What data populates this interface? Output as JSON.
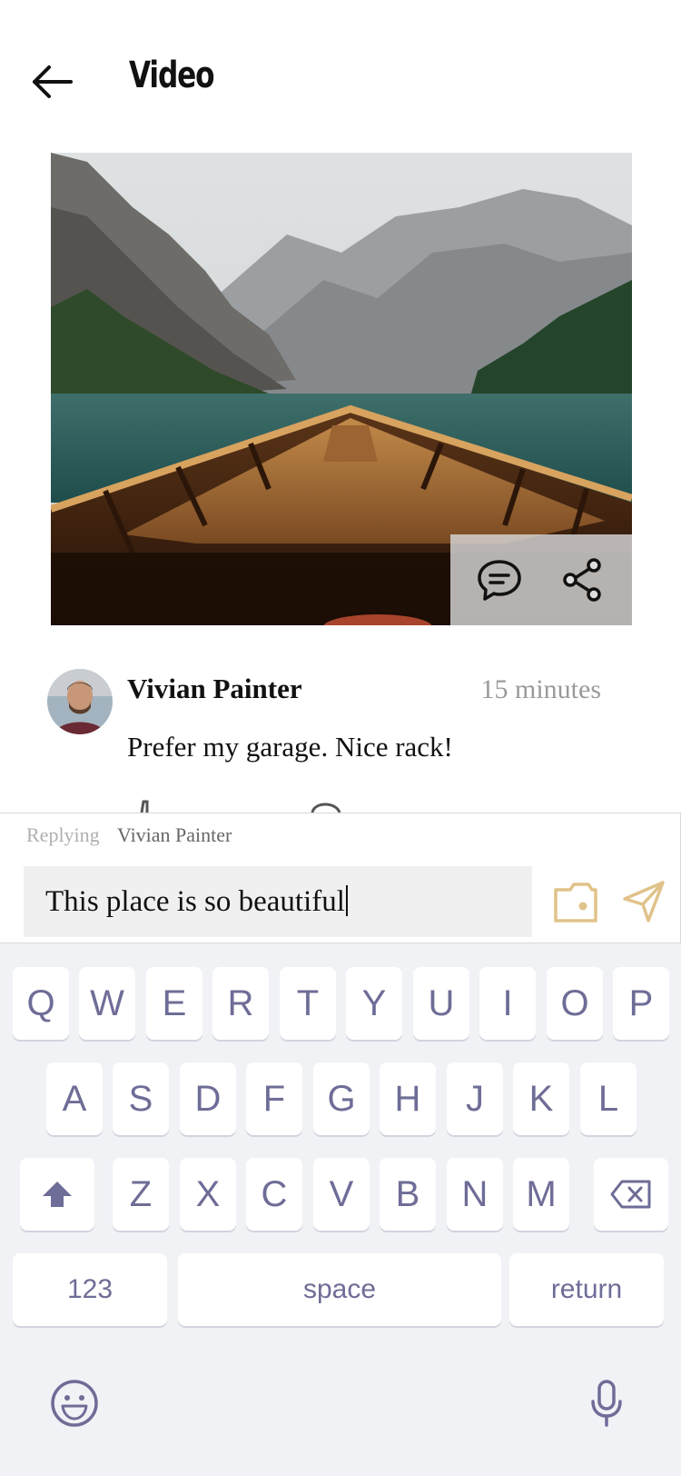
{
  "header": {
    "title": "Video",
    "back_icon": "arrow-left-icon"
  },
  "video": {
    "thumbnail": "mountain lake boat bow",
    "actions": [
      "chat-bubble-icon",
      "share-icon"
    ]
  },
  "comment": {
    "author": "Vivian Painter",
    "time": "15 minutes",
    "text": "Prefer my garage. Nice rack!"
  },
  "reply": {
    "label": "Replying",
    "name": "Vivian Painter"
  },
  "composer": {
    "value": "This place is so beautiful",
    "camera_icon": "camera-icon",
    "send_icon": "send-icon",
    "accent_color": "#e0c38a"
  },
  "keyboard": {
    "row1": [
      "Q",
      "W",
      "E",
      "R",
      "T",
      "Y",
      "U",
      "I",
      "O",
      "P"
    ],
    "row2": [
      "A",
      "S",
      "D",
      "F",
      "G",
      "H",
      "J",
      "K",
      "L"
    ],
    "row3": [
      "Z",
      "X",
      "C",
      "V",
      "B",
      "N",
      "M"
    ],
    "numbers_label": "123",
    "space_label": "space",
    "return_label": "return",
    "key_text_color": "#6e6d97",
    "background_color": "#f1f2f6"
  }
}
